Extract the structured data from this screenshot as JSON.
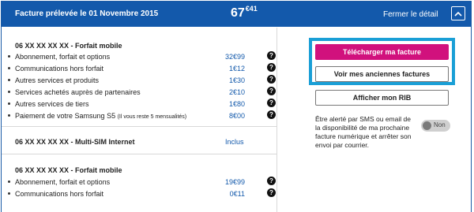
{
  "header": {
    "title": "Facture prélevée le 01 Novembre 2015",
    "amount_main": "67",
    "amount_cents": "€41",
    "close_label": "Fermer le détail"
  },
  "sections": [
    {
      "title": "06 XX XX XX XX - Forfait mobile",
      "rows": [
        {
          "label": "Abonnement, forfait et options",
          "note": "",
          "value": "32€99"
        },
        {
          "label": "Communications hors forfait",
          "note": "",
          "value": "1€12"
        },
        {
          "label": "Autres services et produits",
          "note": "",
          "value": "1€30"
        },
        {
          "label": "Services achetés auprès de partenaires",
          "note": "",
          "value": "2€10"
        },
        {
          "label": "Autres services de tiers",
          "note": "",
          "value": "1€80"
        },
        {
          "label": "Paiement de votre Samsung S5",
          "note": "(Il vous reste 5 mensualités)",
          "value": "8€00"
        }
      ]
    },
    {
      "title": "06 XX XX XX XX - Multi-SIM Internet",
      "value": "Inclus"
    },
    {
      "title": "06 XX XX XX XX - Forfait mobile",
      "rows": [
        {
          "label": "Abonnement, forfait et options",
          "note": "",
          "value": "19€99"
        },
        {
          "label": "Communications hors forfait",
          "note": "",
          "value": "0€11"
        }
      ]
    }
  ],
  "actions": {
    "download": "Télécharger ma facture",
    "older": "Voir mes anciennes factures",
    "rib": "Afficher mon RIB"
  },
  "alert": {
    "text": "Être alerté par SMS ou email de la disponibilité de ma prochaine facture numérique et arrêter son envoi par courrier.",
    "toggle_label": "Non"
  },
  "help_glyph": "?",
  "colors": {
    "header_bg": "#1359ab",
    "value_blue": "#1359ab",
    "primary_button": "#d1117d",
    "highlight_border": "#1a9fd6"
  }
}
